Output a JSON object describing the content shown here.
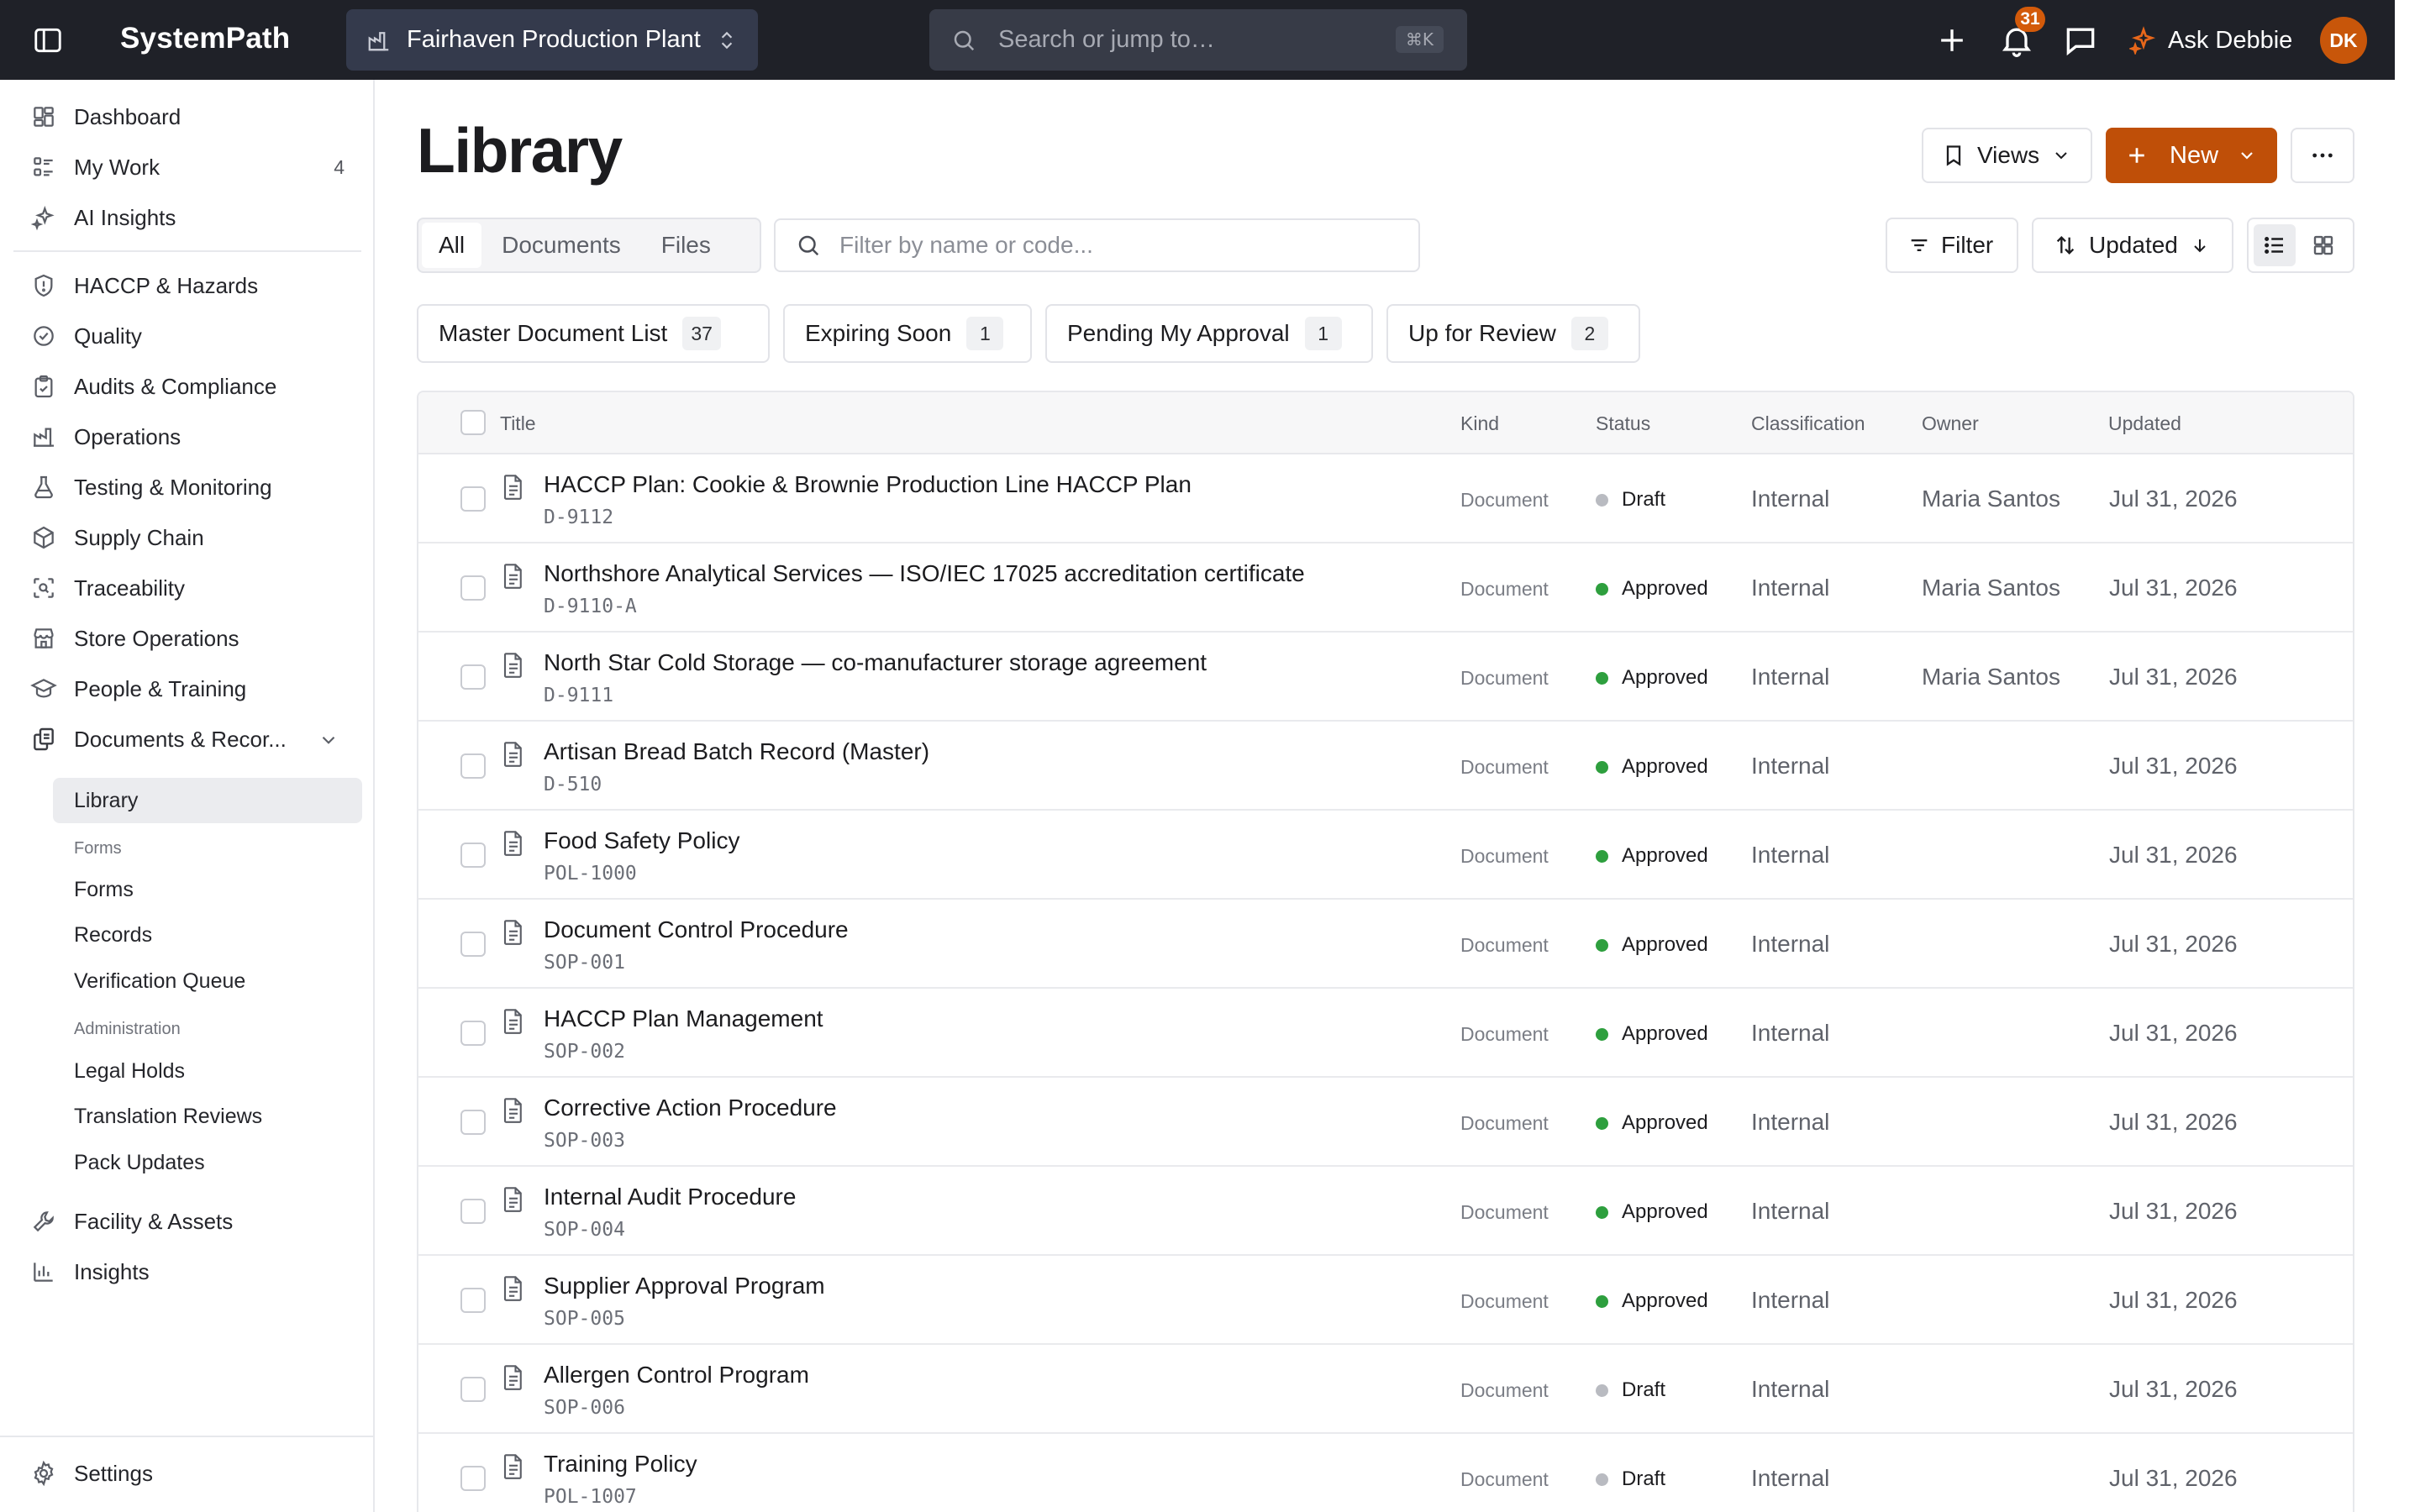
{
  "app": {
    "name": "SystemPath"
  },
  "topbar": {
    "site": "Fairhaven Production Plant",
    "search_placeholder": "Search or jump to…",
    "search_shortcut": "⌘K",
    "notifications_count": "31",
    "assistant_label": "Ask Debbie",
    "avatar_initials": "DK"
  },
  "sidebar": {
    "top_items": [
      {
        "label": "Dashboard",
        "icon": "dashboard-icon"
      },
      {
        "label": "My Work",
        "icon": "list-icon",
        "count": "4"
      },
      {
        "label": "AI Insights",
        "icon": "sparkle-icon"
      }
    ],
    "items": [
      {
        "label": "HACCP & Hazards",
        "icon": "shield-icon"
      },
      {
        "label": "Quality",
        "icon": "check-circle-icon"
      },
      {
        "label": "Audits & Compliance",
        "icon": "clipboard-icon"
      },
      {
        "label": "Operations",
        "icon": "factory-icon"
      },
      {
        "label": "Testing & Monitoring",
        "icon": "flask-icon"
      },
      {
        "label": "Supply Chain",
        "icon": "package-icon"
      },
      {
        "label": "Traceability",
        "icon": "scan-icon"
      },
      {
        "label": "Store Operations",
        "icon": "store-icon"
      },
      {
        "label": "People & Training",
        "icon": "graduation-cap-icon"
      },
      {
        "label": "Documents & Recor...",
        "icon": "documents-icon"
      }
    ],
    "documents_sub": {
      "library": "Library",
      "forms_heading": "Forms",
      "forms_items": [
        "Forms",
        "Records",
        "Verification Queue"
      ],
      "admin_heading": "Administration",
      "admin_items": [
        "Legal Holds",
        "Translation Reviews",
        "Pack Updates"
      ]
    },
    "bottom_items": [
      {
        "label": "Facility & Assets",
        "icon": "wrench-icon"
      },
      {
        "label": "Insights",
        "icon": "bar-chart-icon"
      }
    ],
    "settings_label": "Settings"
  },
  "page": {
    "title": "Library",
    "views_label": "Views",
    "new_label": "New",
    "tabs": [
      "All",
      "Documents",
      "Files"
    ],
    "filter_placeholder": "Filter by name or code...",
    "filter_label": "Filter",
    "sort_label": "Updated",
    "saved_views": [
      {
        "label": "Master Document List",
        "count": "37"
      },
      {
        "label": "Expiring Soon",
        "count": "1"
      },
      {
        "label": "Pending My Approval",
        "count": "1"
      },
      {
        "label": "Up for Review",
        "count": "2"
      }
    ]
  },
  "table": {
    "columns": [
      "Title",
      "Kind",
      "Status",
      "Classification",
      "Owner",
      "Updated"
    ],
    "status_colors": {
      "Draft": "#b9bbc1",
      "Approved": "#2e9f3e"
    },
    "rows": [
      {
        "title": "HACCP Plan: Cookie & Brownie Production Line HACCP Plan",
        "code": "D-9112",
        "kind": "Document",
        "status": "Draft",
        "classification": "Internal",
        "owner": "Maria Santos",
        "updated": "Jul 31, 2026"
      },
      {
        "title": "Northshore Analytical Services — ISO/IEC 17025 accreditation certificate",
        "code": "D-9110-A",
        "kind": "Document",
        "status": "Approved",
        "classification": "Internal",
        "owner": "Maria Santos",
        "updated": "Jul 31, 2026"
      },
      {
        "title": "North Star Cold Storage — co-manufacturer storage agreement",
        "code": "D-9111",
        "kind": "Document",
        "status": "Approved",
        "classification": "Internal",
        "owner": "Maria Santos",
        "updated": "Jul 31, 2026"
      },
      {
        "title": "Artisan Bread Batch Record (Master)",
        "code": "D-510",
        "kind": "Document",
        "status": "Approved",
        "classification": "Internal",
        "owner": "",
        "updated": "Jul 31, 2026"
      },
      {
        "title": "Food Safety Policy",
        "code": "POL-1000",
        "kind": "Document",
        "status": "Approved",
        "classification": "Internal",
        "owner": "",
        "updated": "Jul 31, 2026"
      },
      {
        "title": "Document Control Procedure",
        "code": "SOP-001",
        "kind": "Document",
        "status": "Approved",
        "classification": "Internal",
        "owner": "",
        "updated": "Jul 31, 2026"
      },
      {
        "title": "HACCP Plan Management",
        "code": "SOP-002",
        "kind": "Document",
        "status": "Approved",
        "classification": "Internal",
        "owner": "",
        "updated": "Jul 31, 2026"
      },
      {
        "title": "Corrective Action Procedure",
        "code": "SOP-003",
        "kind": "Document",
        "status": "Approved",
        "classification": "Internal",
        "owner": "",
        "updated": "Jul 31, 2026"
      },
      {
        "title": "Internal Audit Procedure",
        "code": "SOP-004",
        "kind": "Document",
        "status": "Approved",
        "classification": "Internal",
        "owner": "",
        "updated": "Jul 31, 2026"
      },
      {
        "title": "Supplier Approval Program",
        "code": "SOP-005",
        "kind": "Document",
        "status": "Approved",
        "classification": "Internal",
        "owner": "",
        "updated": "Jul 31, 2026"
      },
      {
        "title": "Allergen Control Program",
        "code": "SOP-006",
        "kind": "Document",
        "status": "Draft",
        "classification": "Internal",
        "owner": "",
        "updated": "Jul 31, 2026"
      },
      {
        "title": "Training Policy",
        "code": "POL-1007",
        "kind": "Document",
        "status": "Draft",
        "classification": "Internal",
        "owner": "",
        "updated": "Jul 31, 2026"
      }
    ]
  }
}
